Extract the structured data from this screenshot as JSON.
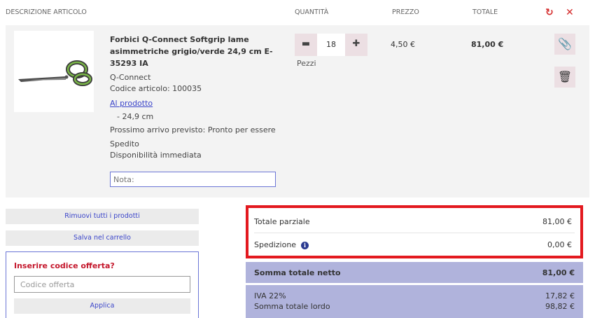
{
  "header": {
    "col_desc": "DESCRIZIONE ARTICOLO",
    "col_qty": "QUANTITÀ",
    "col_price": "PREZZO",
    "col_total": "TOTALE",
    "refresh_icon": "↻",
    "close_icon": "✕"
  },
  "item": {
    "title": "Forbici Q-Connect Softgrip lame asimmetriche grigio/verde 24,9 cm E-35293 IA",
    "brand": "Q-Connect",
    "code": "Codice articolo: 100035",
    "link": "Al prodotto",
    "size": "- 24,9 cm",
    "arrival": "Prossimo arrivo previsto: Pronto per essere",
    "shipped": "Spedito",
    "availability": "Disponibilità immediata",
    "note_placeholder": "Nota:",
    "qty": "18",
    "unit": "Pezzi",
    "price": "4,50 €",
    "total": "81,00 €"
  },
  "actions": {
    "remove_all": "Rimuovi tutti i prodotti",
    "save_cart": "Salva nel carrello"
  },
  "offer": {
    "label": "Inserire codice offerta?",
    "placeholder": "Codice offerta",
    "apply": "Applica"
  },
  "summary": {
    "subtotal_label": "Totale parziale",
    "subtotal_value": "81,00 €",
    "shipping_label": "Spedizione",
    "shipping_value": "0,00 €",
    "net_label": "Somma totale netto",
    "net_value": "81,00 €",
    "vat_label": "IVA 22%",
    "vat_value": "17,82 €",
    "gross_label": "Somma totale lordo",
    "gross_value": "98,82 €"
  },
  "colors": {
    "accent_red": "#c4172c",
    "link_blue": "#3a44c9",
    "summary_bg": "#b0b3dc",
    "highlight_border": "#e3191f"
  }
}
